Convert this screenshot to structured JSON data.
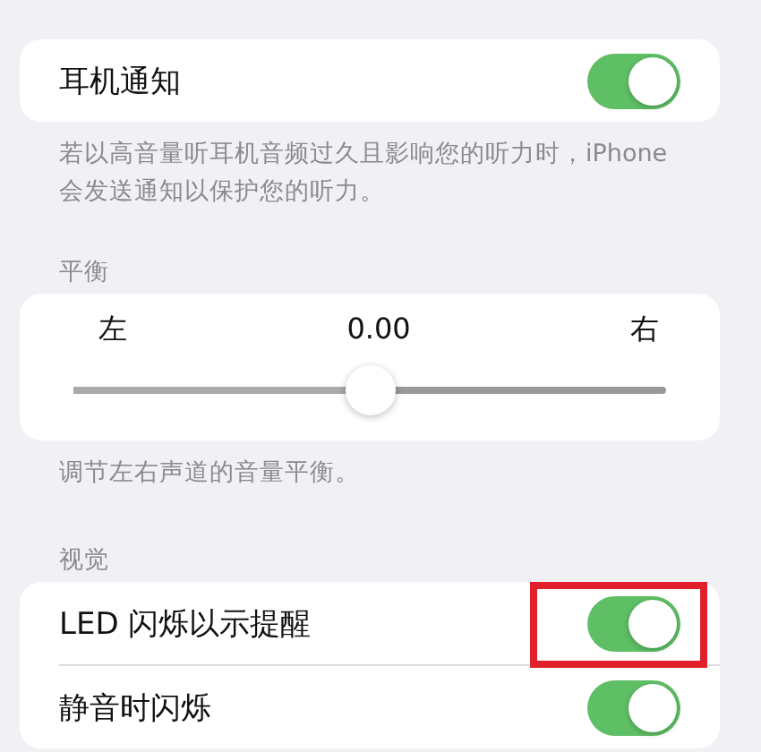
{
  "headphone_notification": {
    "label": "耳机通知",
    "on": true,
    "footer": "若以高音量听耳机音频过久且影响您的听力时，iPhone 会发送通知以保护您的听力。"
  },
  "balance": {
    "header": "平衡",
    "left_label": "左",
    "value": "0.00",
    "right_label": "右",
    "level": 0.5,
    "footer": "调节左右声道的音量平衡。"
  },
  "visual": {
    "header": "视觉",
    "rows": [
      {
        "label": "LED 闪烁以示提醒",
        "on": true,
        "highlighted": true
      },
      {
        "label": "静音时闪烁",
        "on": true,
        "highlighted": false
      }
    ]
  }
}
